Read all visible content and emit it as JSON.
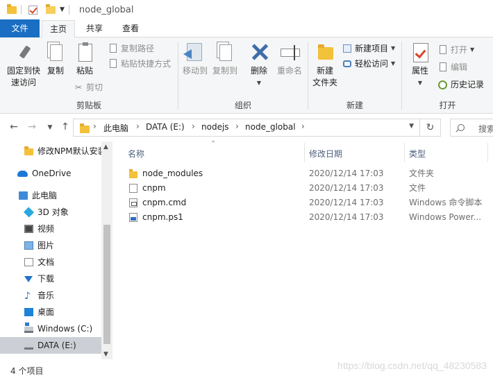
{
  "window": {
    "title": "node_global"
  },
  "tabs": [
    {
      "label": "文件"
    },
    {
      "label": "主页"
    },
    {
      "label": "共享"
    },
    {
      "label": "查看"
    }
  ],
  "ribbon": {
    "clipboard": {
      "label": "剪贴板",
      "pin_line1": "固定到快",
      "pin_line2": "速访问",
      "copy": "复制",
      "paste": "粘贴",
      "copy_path": "复制路径",
      "paste_shortcut": "粘贴快捷方式",
      "cut": "剪切"
    },
    "organize": {
      "label": "组织",
      "move_to": "移动到",
      "copy_to": "复制到",
      "delete": "删除",
      "rename": "重命名"
    },
    "new": {
      "label": "新建",
      "new_folder_line1": "新建",
      "new_folder_line2": "文件夹",
      "new_item": "新建项目",
      "easy_access": "轻松访问"
    },
    "open": {
      "label": "打开",
      "properties": "属性",
      "open": "打开",
      "edit": "编辑",
      "history": "历史记录"
    }
  },
  "address": {
    "crumbs": [
      "此电脑",
      "DATA (E:)",
      "nodejs",
      "node_global"
    ],
    "search_placeholder": "搜索"
  },
  "nav": {
    "items": [
      {
        "label": "修改NPM默认安装",
        "icon": "folder-icon"
      },
      {
        "label": "OneDrive",
        "icon": "cloud-icon"
      },
      {
        "label": "此电脑",
        "icon": "computer-icon"
      },
      {
        "label": "3D 对象",
        "icon": "cube-icon"
      },
      {
        "label": "视频",
        "icon": "video-icon"
      },
      {
        "label": "图片",
        "icon": "pictures-icon"
      },
      {
        "label": "文档",
        "icon": "documents-icon"
      },
      {
        "label": "下载",
        "icon": "download-icon"
      },
      {
        "label": "音乐",
        "icon": "music-icon"
      },
      {
        "label": "桌面",
        "icon": "desktop-icon"
      },
      {
        "label": "Windows (C:)",
        "icon": "drive-icon"
      },
      {
        "label": "DATA (E:)",
        "icon": "drive-icon"
      }
    ],
    "selected": "DATA (E:)"
  },
  "columns": {
    "name": "名称",
    "date": "修改日期",
    "type": "类型"
  },
  "files": [
    {
      "name": "node_modules",
      "date": "2020/12/14 17:03",
      "type": "文件夹",
      "icon": "folder-icon"
    },
    {
      "name": "cnpm",
      "date": "2020/12/14 17:03",
      "type": "文件",
      "icon": "file-icon"
    },
    {
      "name": "cnpm.cmd",
      "date": "2020/12/14 17:03",
      "type": "Windows 命令脚本",
      "icon": "cmd-script-icon"
    },
    {
      "name": "cnpm.ps1",
      "date": "2020/12/14 17:03",
      "type": "Windows Power...",
      "icon": "powershell-script-icon"
    }
  ],
  "status": {
    "count": "4 个项目",
    "watermark": "https://blog.csdn.net/qq_48230583"
  },
  "colors": {
    "accent": "#1a6fc3",
    "selected_nav": "#ccd0d6",
    "folder": "#f3c13a"
  }
}
